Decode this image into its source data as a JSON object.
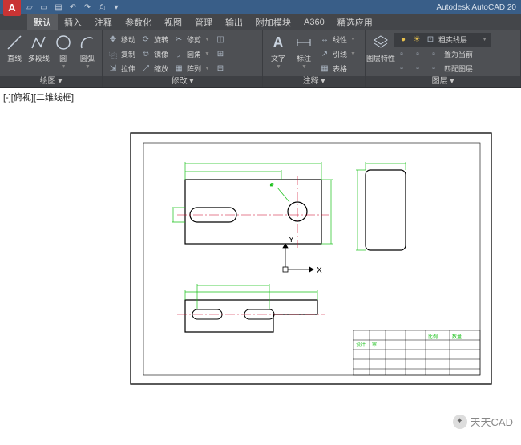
{
  "app": {
    "title": "Autodesk AutoCAD 20",
    "logo": "A"
  },
  "tabs": {
    "t0": "默认",
    "t1": "插入",
    "t2": "注释",
    "t3": "参数化",
    "t4": "视图",
    "t5": "管理",
    "t6": "输出",
    "t7": "附加模块",
    "t8": "A360",
    "t9": "精选应用"
  },
  "ribbon": {
    "draw": {
      "title": "绘图 ▾",
      "line": "直线",
      "polyline": "多段线",
      "circle": "圆",
      "arc": "圆弧"
    },
    "modify": {
      "title": "修改 ▾",
      "move": "移动",
      "copy": "复制",
      "stretch": "拉伸",
      "rotate": "旋转",
      "mirror": "镜像",
      "scale": "缩放",
      "trim": "修剪",
      "fillet": "圆角",
      "array": "阵列"
    },
    "annotate": {
      "title": "注释 ▾",
      "text": "文字",
      "dim": "标注",
      "linear": "线性",
      "leader": "引线",
      "table": "表格"
    },
    "layers": {
      "title": "图层 ▾",
      "props": "图层特性",
      "current": "置为当前",
      "match": "匹配图层",
      "layer_name": "粗实线层"
    }
  },
  "viewport": {
    "label": "[-][俯视][二维线框]"
  },
  "axes": {
    "x": "X",
    "y": "Y"
  },
  "watermark": {
    "text": "天天CAD"
  }
}
